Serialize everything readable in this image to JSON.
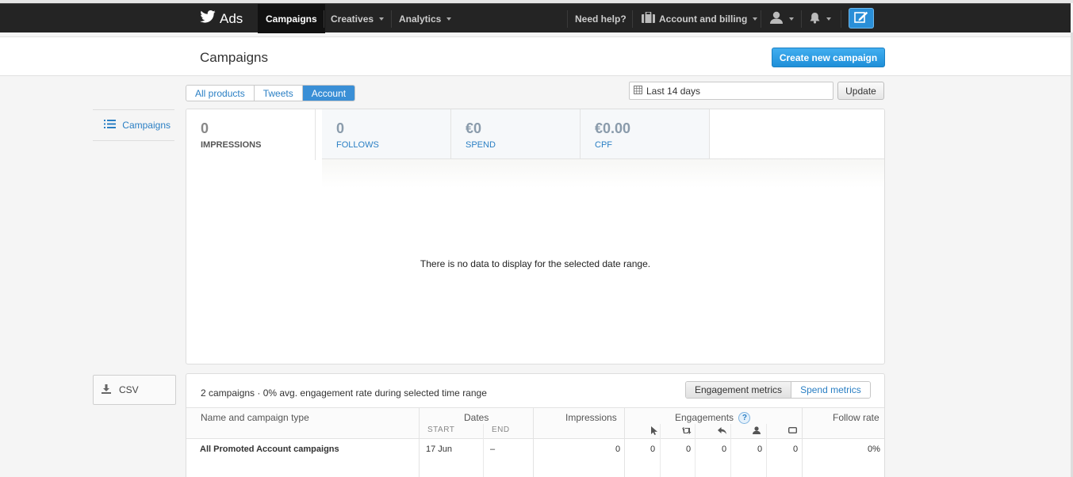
{
  "topbar": {
    "brand": "Ads",
    "nav": [
      {
        "label": "Campaigns",
        "active": true
      },
      {
        "label": "Creatives",
        "active": false
      },
      {
        "label": "Analytics",
        "active": false
      }
    ],
    "help_label": "Need help?",
    "account_label": "Account and billing"
  },
  "header": {
    "title": "Campaigns",
    "create_label": "Create new campaign"
  },
  "filters": {
    "tabs": [
      "All products",
      "Tweets",
      "Account"
    ],
    "active_tab": "Account",
    "date_range": "Last 14 days",
    "update_label": "Update"
  },
  "sidebar": {
    "campaigns_label": "Campaigns",
    "csv_label": "CSV"
  },
  "metrics": [
    {
      "value": "0",
      "label": "IMPRESSIONS",
      "active": true
    },
    {
      "value": "0",
      "label": "FOLLOWS",
      "active": false
    },
    {
      "value": "€0",
      "label": "SPEND",
      "active": false
    },
    {
      "value": "€0.00",
      "label": "CPF",
      "active": false
    }
  ],
  "chart": {
    "empty_message": "There is no data to display for the selected date range."
  },
  "table": {
    "summary": "2 campaigns · 0% avg. engagement rate during selected time range",
    "toggle": [
      "Engagement metrics",
      "Spend metrics"
    ],
    "headers": {
      "name": "Name and campaign type",
      "dates": "Dates",
      "start": "START",
      "end": "END",
      "impressions": "Impressions",
      "engagements": "Engagements",
      "follow_rate": "Follow rate"
    },
    "help_glyph": "?",
    "rows": [
      {
        "name": "All Promoted Account campaigns",
        "start": "17 Jun",
        "end": "–",
        "impressions": "0",
        "eng_clicks": "0",
        "eng_retweets": "0",
        "eng_replies": "0",
        "eng_follows": "0",
        "eng_cards": "0",
        "follow_rate": "0%"
      }
    ]
  },
  "colors": {
    "accent": "#2a7fc4",
    "primary_button": "#1f8fd8",
    "topbar": "#242424"
  },
  "icons": [
    "twitter-bird-icon",
    "caret-down-icon",
    "briefcase-icon",
    "user-icon",
    "bell-icon",
    "compose-icon",
    "list-icon",
    "calendar-icon",
    "download-icon",
    "help-icon",
    "cursor-icon",
    "retweet-icon",
    "reply-icon",
    "follow-icon",
    "card-icon"
  ]
}
